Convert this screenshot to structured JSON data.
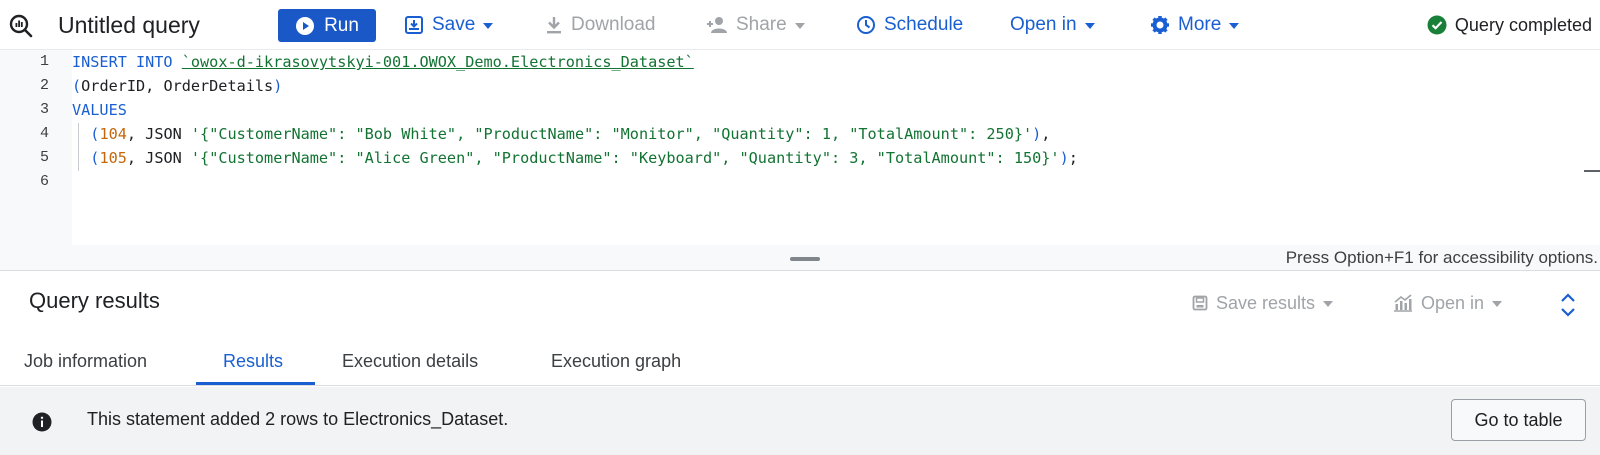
{
  "toolbar": {
    "title": "Untitled query",
    "run_label": "Run",
    "save_label": "Save",
    "download_label": "Download",
    "share_label": "Share",
    "schedule_label": "Schedule",
    "open_in_label": "Open in",
    "more_label": "More",
    "status": "Query completed"
  },
  "editor": {
    "line_numbers": [
      "1",
      "2",
      "3",
      "4",
      "5",
      "6"
    ],
    "line1": {
      "kw": "INSERT INTO",
      "table": "`owox-d-ikrasovytskyi-001.OWOX_Demo.Electronics_Dataset`"
    },
    "line2": {
      "open": "(",
      "cols": "OrderID, OrderDetails",
      "close": ")"
    },
    "line3": {
      "kw": "VALUES"
    },
    "line4": {
      "open": "(",
      "num": "104",
      "mid": ", JSON ",
      "str": "'{\"CustomerName\": \"Bob White\", \"ProductName\": \"Monitor\", \"Quantity\": 1, \"TotalAmount\": 250}'",
      "close": ")",
      "end": ","
    },
    "line5": {
      "open": "(",
      "num": "105",
      "mid": ", JSON ",
      "str": "'{\"CustomerName\": \"Alice Green\", \"ProductName\": \"Keyboard\", \"Quantity\": 3, \"TotalAmount\": 150}'",
      "close": ")",
      "end": ";"
    },
    "accessibility_hint": "Press Option+F1 for accessibility options."
  },
  "results": {
    "title": "Query results",
    "save_results_label": "Save results",
    "open_in_label": "Open in",
    "tabs": [
      {
        "label": "Job information"
      },
      {
        "label": "Results"
      },
      {
        "label": "Execution details"
      },
      {
        "label": "Execution graph"
      }
    ],
    "active_tab": "Results",
    "message": "This statement added 2 rows to Electronics_Dataset.",
    "goto_label": "Go to table"
  },
  "colors": {
    "accent": "#1a5fd1",
    "run_button": "#1a57c7",
    "status_ok": "#188038",
    "string": "#137333",
    "number": "#c5660a"
  }
}
